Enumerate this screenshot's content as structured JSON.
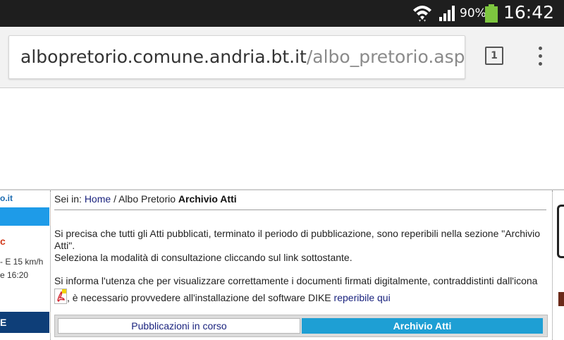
{
  "status_bar": {
    "battery": "90%",
    "time": "16:42",
    "icons": [
      "wifi-icon",
      "signal-icon",
      "battery-icon"
    ],
    "battery_color": "#7dc63f"
  },
  "browser": {
    "url_host": "albopretorio.comune.andria.bt.it",
    "url_path": "/albo_pretorio.asp?n",
    "tab_count": "1"
  },
  "left_sidebar": {
    "link": "o.it",
    "alert": "c",
    "weather_1": "- E 15 km/h",
    "weather_2": "e 16:20",
    "dark_label": "E"
  },
  "content": {
    "breadcrumb": {
      "prefix": "Sei in:",
      "home": "Home",
      "separator": "/",
      "albo": "Albo Pretorio",
      "current": "Archivio Atti"
    },
    "para1": "Si precisa che tutti gli Atti pubblicati, terminato il periodo di pubblicazione, sono reperibili nella sezione \"Archivio Atti\".",
    "para2": "Seleziona la modalità di consultazione cliccando sul link sottostante.",
    "para3_a": "Si informa l'utenza che per visualizzare correttamente i documenti firmati digitalmente, contraddistinti dall'icona",
    "para3_b": ", è necessario provvedere all'installazione del software DIKE",
    "para3_link": "reperibile qui",
    "tabs": [
      {
        "label": "Pubblicazioni in corso",
        "active": false
      },
      {
        "label": "Archivio Atti",
        "active": true
      }
    ]
  },
  "colors": {
    "accent_blue": "#1e9fd4",
    "link_blue": "#1a237e",
    "sidebar_dark": "#0e3e78"
  }
}
